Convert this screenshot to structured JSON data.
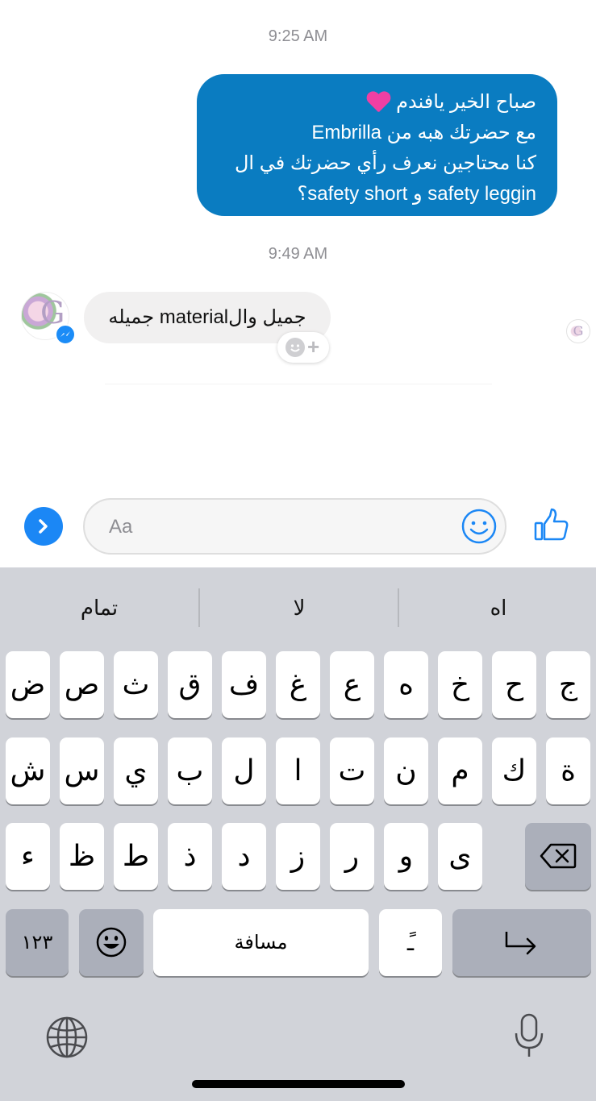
{
  "thread": {
    "time_1": "9:25 AM",
    "outgoing_message": {
      "line_1": "صباح الخير يافندم",
      "line_2": "مع حضرتك هبه من Embrilla",
      "line_3": "كنا محتاجين نعرف رأي حضرتك في ال",
      "line_4": "safety leggin و safety short؟"
    },
    "time_2": "9:49 AM",
    "incoming_message": "جميل والmaterial جميله",
    "avatar_letter": "G",
    "seen_avatar_letter": "G",
    "react_plus": "+"
  },
  "composer": {
    "placeholder": "Aa"
  },
  "keyboard": {
    "suggestions": [
      "تمام",
      "لا",
      "اه"
    ],
    "row1": [
      "ض",
      "ص",
      "ث",
      "ق",
      "ف",
      "غ",
      "ع",
      "ه",
      "خ",
      "ح",
      "ج"
    ],
    "row2": [
      "ش",
      "س",
      "ي",
      "ب",
      "ل",
      "ا",
      "ت",
      "ن",
      "م",
      "ك",
      "ة"
    ],
    "row3": [
      "ء",
      "ظ",
      "ط",
      "ذ",
      "د",
      "ز",
      "ر",
      "و",
      "ى"
    ],
    "numbers_key": "١٢٣",
    "space_key": "مسافة",
    "diacritic_key": "ًـ"
  },
  "colors": {
    "outgoing_bubble": "#0a7cc1",
    "accent_blue": "#1b87f5"
  }
}
